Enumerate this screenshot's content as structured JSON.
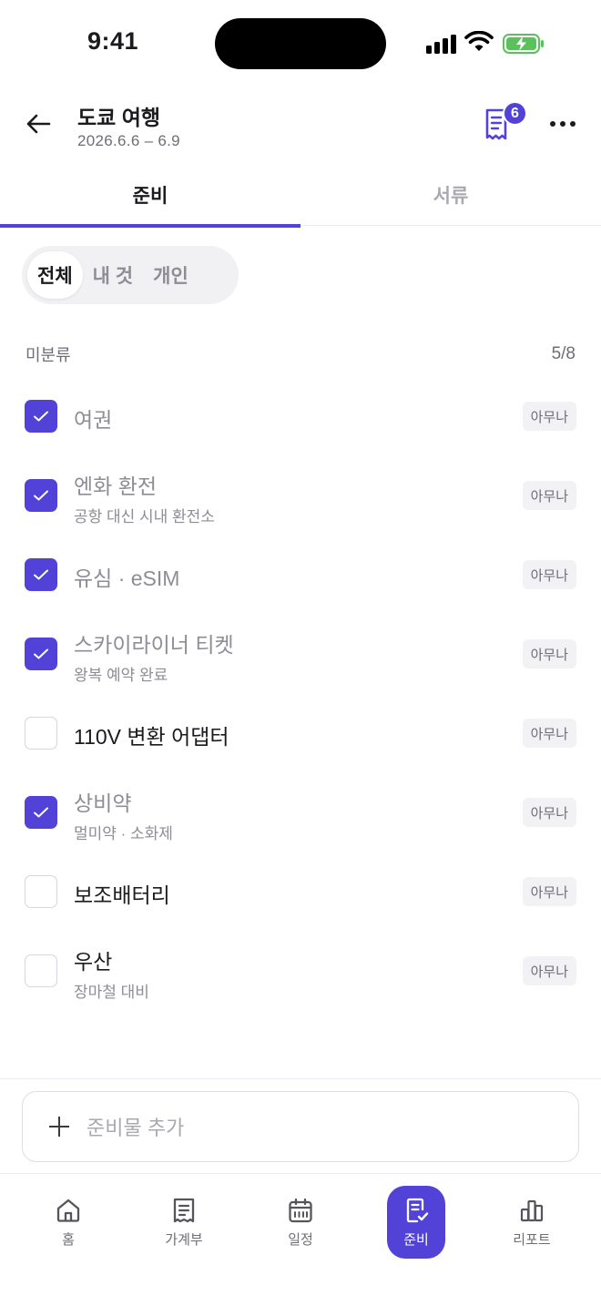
{
  "status_bar": {
    "time": "9:41"
  },
  "header": {
    "title": "도쿄 여행",
    "dates": "2026.6.6 – 6.9",
    "receipt_badge": "6"
  },
  "tabs": [
    {
      "label": "준비",
      "active": true
    },
    {
      "label": "서류",
      "active": false
    }
  ],
  "filters": [
    {
      "label": "전체",
      "active": true
    },
    {
      "label": "내 것",
      "active": false
    },
    {
      "label": "개인",
      "active": false
    }
  ],
  "section": {
    "label": "미분류",
    "count": "5/8"
  },
  "items": [
    {
      "title": "여권",
      "subtitle": "",
      "checked": true,
      "assignee": "아무나"
    },
    {
      "title": "엔화 환전",
      "subtitle": "공항 대신 시내 환전소",
      "checked": true,
      "assignee": "아무나"
    },
    {
      "title": "유심 · eSIM",
      "subtitle": "",
      "checked": true,
      "assignee": "아무나"
    },
    {
      "title": "스카이라이너 티켓",
      "subtitle": "왕복 예약 완료",
      "checked": true,
      "assignee": "아무나"
    },
    {
      "title": "110V 변환 어댑터",
      "subtitle": "",
      "checked": false,
      "assignee": "아무나"
    },
    {
      "title": "상비약",
      "subtitle": "멀미약 · 소화제",
      "checked": true,
      "assignee": "아무나"
    },
    {
      "title": "보조배터리",
      "subtitle": "",
      "checked": false,
      "assignee": "아무나"
    },
    {
      "title": "우산",
      "subtitle": "장마철 대비",
      "checked": false,
      "assignee": "아무나"
    }
  ],
  "add_bar": {
    "placeholder": "준비물 추가"
  },
  "bottom_nav": [
    {
      "label": "홈",
      "icon": "home-icon",
      "active": false
    },
    {
      "label": "가계부",
      "icon": "receipt-icon",
      "active": false
    },
    {
      "label": "일정",
      "icon": "calendar-icon",
      "active": false
    },
    {
      "label": "준비",
      "icon": "checklist-icon",
      "active": true
    },
    {
      "label": "리포트",
      "icon": "bar-chart-icon",
      "active": false
    }
  ],
  "colors": {
    "accent": "#5242d8",
    "text": "#1b1b1f",
    "muted": "#8d8d95",
    "chip_bg": "#f2f2f5"
  }
}
